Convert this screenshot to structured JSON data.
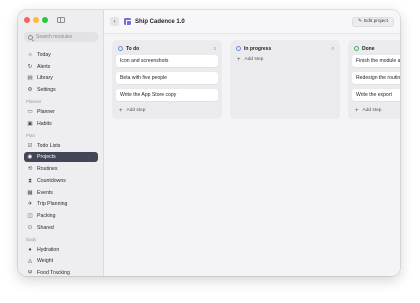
{
  "sidebar": {
    "search_placeholder": "Search modules",
    "items_top": [
      {
        "label": "Today",
        "icon": "sun-icon",
        "glyph": "☼"
      },
      {
        "label": "Alerts",
        "icon": "alert-icon",
        "glyph": "↻"
      },
      {
        "label": "Library",
        "icon": "library-icon",
        "glyph": "▤"
      },
      {
        "label": "Settings",
        "icon": "gear-icon",
        "glyph": "⚙"
      }
    ],
    "section_planner": "Planner",
    "items_planner": [
      {
        "label": "Planner",
        "icon": "planner-icon",
        "glyph": "▭"
      },
      {
        "label": "Habits",
        "icon": "habits-icon",
        "glyph": "▣"
      }
    ],
    "section_plan": "Plan",
    "items_plan": [
      {
        "label": "Todo Lists",
        "icon": "checklist-icon",
        "glyph": "☑"
      },
      {
        "label": "Projects",
        "icon": "projects-icon",
        "glyph": "◉",
        "active": true
      },
      {
        "label": "Routines",
        "icon": "routines-icon",
        "glyph": "⟲"
      },
      {
        "label": "Countdowns",
        "icon": "hourglass-icon",
        "glyph": "⧗"
      },
      {
        "label": "Events",
        "icon": "calendar-icon",
        "glyph": "▦"
      },
      {
        "label": "Trip Planning",
        "icon": "plane-icon",
        "glyph": "✈"
      },
      {
        "label": "Packing",
        "icon": "bag-icon",
        "glyph": "◫"
      },
      {
        "label": "Shared",
        "icon": "people-icon",
        "glyph": "⚇"
      }
    ],
    "section_body": "Body",
    "items_body": [
      {
        "label": "Hydration",
        "icon": "drop-icon",
        "glyph": "●"
      },
      {
        "label": "Weight",
        "icon": "weight-icon",
        "glyph": "◬"
      },
      {
        "label": "Food Tracking",
        "icon": "food-icon",
        "glyph": "Ψ"
      }
    ]
  },
  "toolbar": {
    "back_glyph": "‹",
    "title": "Ship Cadence 1.0",
    "edit_label": "Edit project",
    "edit_glyph": "✎"
  },
  "columns": [
    {
      "title": "To do",
      "count": "3",
      "status": "todo",
      "cards": [
        "Icon and screenshots",
        "Beta with five people",
        "Write the App Store copy"
      ],
      "add_label": "Add step"
    },
    {
      "title": "In progress",
      "count": "0",
      "status": "prog",
      "cards": [],
      "add_label": "Add step"
    },
    {
      "title": "Done",
      "count": "3",
      "status": "done",
      "cards": [
        "Finish the module audit",
        "Redesign the routine editor",
        "Write the export"
      ],
      "add_label": "Add step"
    }
  ]
}
